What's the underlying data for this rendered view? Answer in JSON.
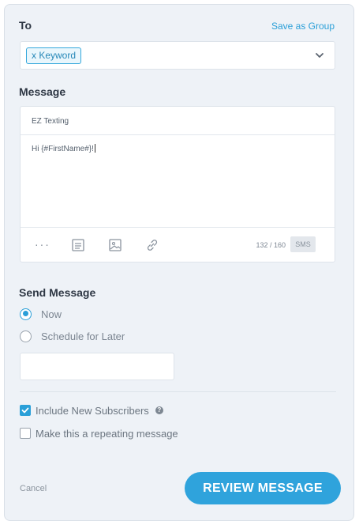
{
  "to": {
    "label": "To",
    "save_as_group": "Save as Group",
    "tag": "x Keyword"
  },
  "message": {
    "label": "Message",
    "sender": "EZ Texting",
    "body": "Hi {#FirstName#}!",
    "counter": "132 / 160",
    "badge": "SMS"
  },
  "send": {
    "label": "Send Message",
    "options": [
      {
        "label": "Now",
        "selected": true
      },
      {
        "label": "Schedule for Later",
        "selected": false
      }
    ],
    "schedule_value": ""
  },
  "options": {
    "include_new": {
      "label": "Include New Subscribers",
      "checked": true
    },
    "repeating": {
      "label": "Make this a repeating message",
      "checked": false
    }
  },
  "actions": {
    "cancel": "Cancel",
    "review": "REVIEW MESSAGE"
  },
  "icons": [
    "variable-braces-icon",
    "template-icon",
    "image-icon",
    "link-icon",
    "chevron-down-icon",
    "help-icon",
    "checkmark-icon"
  ],
  "colors": {
    "accent": "#2a9fd8",
    "panel_bg": "#eef2f7"
  }
}
